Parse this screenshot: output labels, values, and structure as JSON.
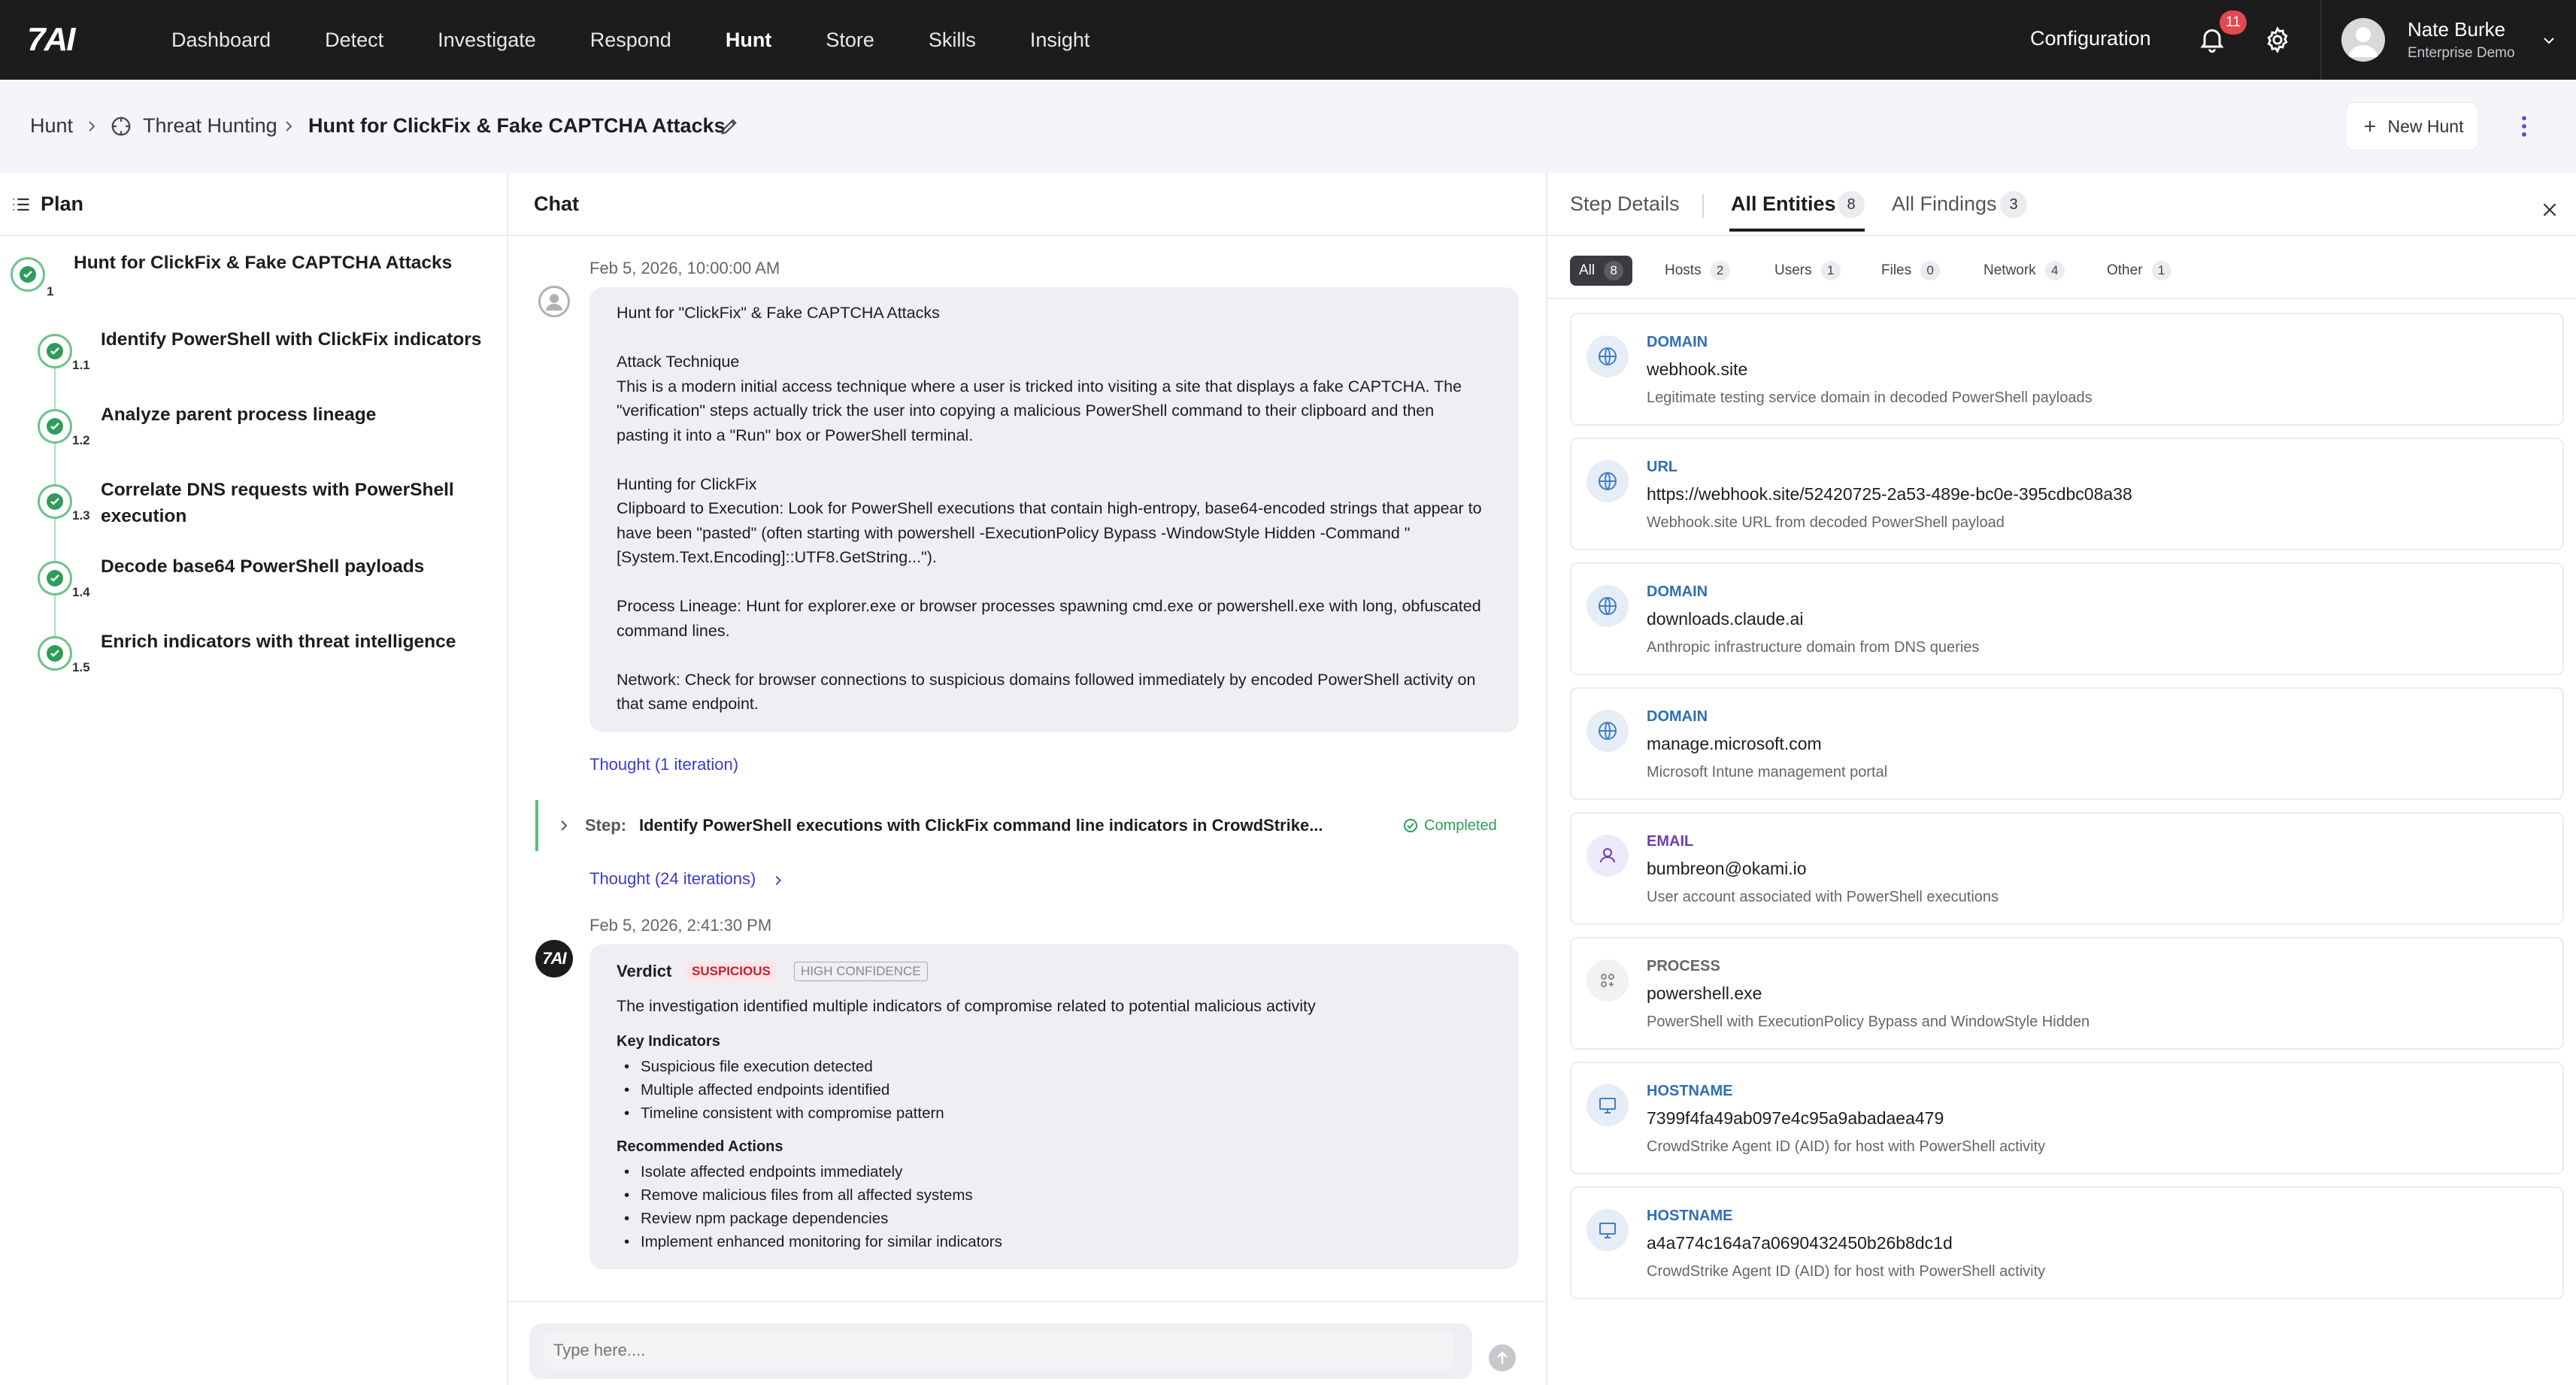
{
  "brand": {
    "logo": "7AI"
  },
  "nav": [
    "Dashboard",
    "Detect",
    "Investigate",
    "Respond",
    "Hunt",
    "Store",
    "Skills",
    "Insight"
  ],
  "nav_active": "Hunt",
  "header": {
    "configuration": "Configuration",
    "notifications": "11",
    "user_name": "Nate Burke",
    "user_org": "Enterprise Demo"
  },
  "breadcrumb": {
    "root": "Hunt",
    "section": "Threat Hunting",
    "current": "Hunt for ClickFix & Fake CAPTCHA Attacks",
    "new_hunt": "New Hunt"
  },
  "plan": {
    "title": "Plan",
    "items": [
      {
        "num": "1",
        "label": "Hunt for ClickFix & Fake CAPTCHA Attacks"
      },
      {
        "num": "1.1",
        "label": "Identify PowerShell with ClickFix indicators"
      },
      {
        "num": "1.2",
        "label": "Analyze parent process lineage"
      },
      {
        "num": "1.3",
        "label": "Correlate DNS requests with PowerShell",
        "label2": "execution"
      },
      {
        "num": "1.4",
        "label": "Decode base64 PowerShell payloads"
      },
      {
        "num": "1.5",
        "label": "Enrich indicators with threat intelligence"
      }
    ]
  },
  "chat": {
    "title": "Chat",
    "msg1_time": "Feb 5, 2026, 10:00:00 AM",
    "msg1_lines": [
      "Hunt for \"ClickFix\" & Fake CAPTCHA Attacks",
      "",
      "Attack Technique",
      "This is a modern initial access technique where a user is tricked into visiting a site that displays a fake CAPTCHA. The",
      "\"verification\" steps actually trick the user into copying a malicious PowerShell command to their clipboard and then",
      "pasting it into a \"Run\" box or PowerShell terminal.",
      "",
      "Hunting for ClickFix",
      "Clipboard to Execution: Look for PowerShell executions that contain high-entropy, base64-encoded strings that appear to",
      "have been \"pasted\" (often starting with powershell -ExecutionPolicy Bypass -WindowStyle Hidden -Command \"",
      "[System.Text.Encoding]::UTF8.GetString...\").",
      "",
      "Process Lineage: Hunt for explorer.exe or browser processes spawning cmd.exe or powershell.exe with long, obfuscated",
      "command lines.",
      "",
      "Network: Check for browser connections to suspicious domains followed immediately by encoded PowerShell activity on",
      "that same endpoint."
    ],
    "thought1": "Thought (1 iteration)",
    "step_label": "Step:",
    "step_text": "Identify PowerShell executions with ClickFix command line indicators in CrowdStrike...",
    "step_status": "Completed",
    "thought2": "Thought (24 iterations)",
    "msg2_time": "Feb 5, 2026, 2:41:30 PM",
    "bot_avatar": "7AI",
    "verdict_label": "Verdict",
    "verdict_tag": "SUSPICIOUS",
    "confidence_tag": "HIGH CONFIDENCE",
    "verdict_summary": "The investigation identified multiple indicators of compromise related to potential malicious activity",
    "key_indicators_title": "Key Indicators",
    "key_indicators": [
      "Suspicious file execution detected",
      "Multiple affected endpoints identified",
      "Timeline consistent with compromise pattern"
    ],
    "actions_title": "Recommended Actions",
    "actions": [
      "Isolate affected endpoints immediately",
      "Remove malicious files from all affected systems",
      "Review npm package dependencies",
      "Implement enhanced monitoring for similar indicators"
    ],
    "input_placeholder": "Type here...."
  },
  "right": {
    "tabs": [
      {
        "label": "Step Details"
      },
      {
        "label": "All Entities",
        "count": "8"
      },
      {
        "label": "All Findings",
        "count": "3"
      }
    ],
    "filters": [
      {
        "label": "All",
        "count": "8"
      },
      {
        "label": "Hosts",
        "count": "2"
      },
      {
        "label": "Users",
        "count": "1"
      },
      {
        "label": "Files",
        "count": "0"
      },
      {
        "label": "Network",
        "count": "4"
      },
      {
        "label": "Other",
        "count": "1"
      }
    ],
    "entities": [
      {
        "type": "DOMAIN",
        "value": "webhook.site",
        "desc": "Legitimate testing service domain in decoded PowerShell payloads",
        "icon": "globe-icon"
      },
      {
        "type": "URL",
        "value": "https://webhook.site/52420725-2a53-489e-bc0e-395cdbc08a38",
        "desc": "Webhook.site URL from decoded PowerShell payload",
        "icon": "globe-icon"
      },
      {
        "type": "DOMAIN",
        "value": "downloads.claude.ai",
        "desc": "Anthropic infrastructure domain from DNS queries",
        "icon": "globe-icon"
      },
      {
        "type": "DOMAIN",
        "value": "manage.microsoft.com",
        "desc": "Microsoft Intune management portal",
        "icon": "globe-icon"
      },
      {
        "type": "EMAIL",
        "value": "bumbreon@okami.io",
        "desc": "User account associated with PowerShell executions",
        "icon": "user-icon"
      },
      {
        "type": "PROCESS",
        "value": "powershell.exe",
        "desc": "PowerShell with ExecutionPolicy Bypass and WindowStyle Hidden",
        "icon": "process-icon"
      },
      {
        "type": "HOSTNAME",
        "value": "7399f4fa49ab097e4c95a9abadaea479",
        "desc": "CrowdStrike Agent ID (AID) for host with PowerShell activity",
        "icon": "monitor-icon"
      },
      {
        "type": "HOSTNAME",
        "value": "a4a774c164a7a0690432450b26b8dc1d",
        "desc": "CrowdStrike Agent ID (AID) for host with PowerShell activity",
        "icon": "monitor-icon"
      }
    ]
  },
  "colors": {
    "topbar": "#1c1c1e",
    "accent_green": "#2f9c5a",
    "link": "#3b3bd1",
    "domain_blue": "#2f6fb3",
    "email_purple": "#6b3fb0",
    "suspicious_red": "#c2222f"
  }
}
